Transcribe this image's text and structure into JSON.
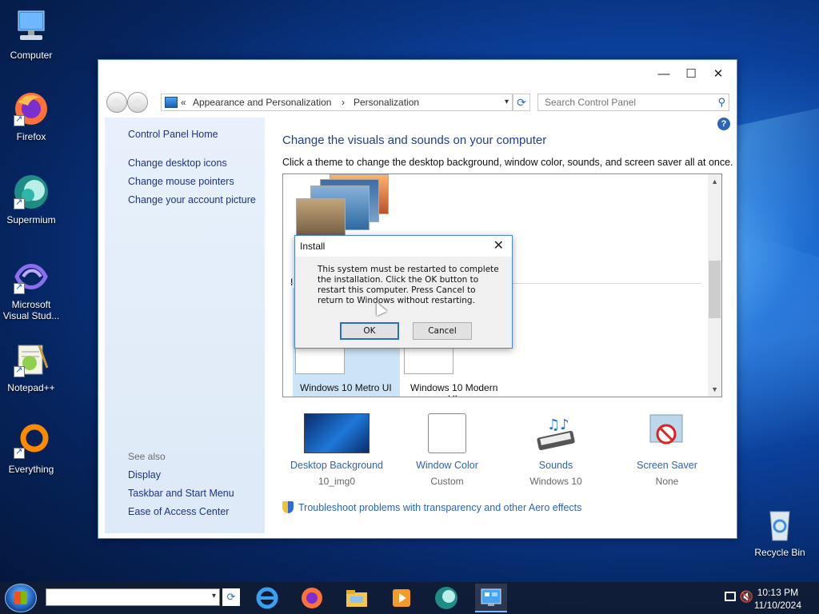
{
  "desktop": {
    "icons": [
      {
        "label": "Computer"
      },
      {
        "label": "Firefox"
      },
      {
        "label": "Supermium"
      },
      {
        "label": "Microsoft Visual Stud..."
      },
      {
        "label": "Notepad++"
      },
      {
        "label": "Everything"
      },
      {
        "label": "Recycle Bin"
      }
    ]
  },
  "window": {
    "controls": {
      "minimize": "—",
      "maximize": "☐",
      "close": "✕"
    },
    "address": {
      "chevron": "«",
      "crumb1": "Appearance and Personalization",
      "separator": "›",
      "crumb2": "Personalization",
      "dropdown": "▾"
    },
    "refresh_glyph": "⟳",
    "search_placeholder": "Search Control Panel",
    "search_glyph": "⚲",
    "help_glyph": "?",
    "left_links": {
      "home": "Control Panel Home",
      "items": [
        "Change desktop icons",
        "Change mouse pointers",
        "Change your account picture"
      ],
      "see_also_label": "See also",
      "see_also": [
        "Display",
        "Taskbar and Start Menu",
        "Ease of Access Center"
      ]
    },
    "heading": "Change the visuals and sounds on your computer",
    "subheading": "Click a theme to change the desktop background, window color, sounds, and screen saver all at once.",
    "themes": {
      "section_letter": "I",
      "tiles": [
        {
          "label": "Windows 10 Metro UI",
          "selected": true
        },
        {
          "label": "Windows 10 Modern"
        }
      ],
      "clipped_label": "UI"
    },
    "customize": [
      {
        "name": "Desktop Background",
        "value": "10_img0"
      },
      {
        "name": "Window Color",
        "value": "Custom"
      },
      {
        "name": "Sounds",
        "value": "Windows 10"
      },
      {
        "name": "Screen Saver",
        "value": "None"
      }
    ],
    "troubleshoot": "Troubleshoot problems with transparency and other Aero effects"
  },
  "dialog": {
    "title": "Install",
    "close": "✕",
    "message": "This system must be restarted to complete\nthe installation. Click the OK button to\nrestart this computer. Press Cancel to\nreturn to Windows without restarting.",
    "ok": "OK",
    "cancel": "Cancel"
  },
  "taskbar": {
    "search_value": "",
    "dropdown": "▾",
    "refresh_glyph": "⟳",
    "apps": [
      "internet-explorer",
      "firefox",
      "file-explorer",
      "media-player",
      "supermium",
      "control-panel"
    ],
    "time": "10:13 PM",
    "date": "11/10/2024"
  },
  "colors": {
    "link": "#2b64b5",
    "heading": "#1d3f8f",
    "accent": "#2a6ebd"
  }
}
